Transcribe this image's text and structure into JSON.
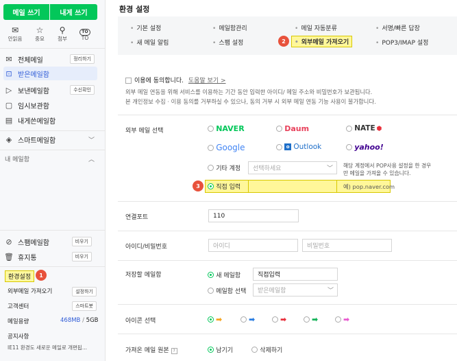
{
  "sidebar": {
    "write_button": "메일 쓰기",
    "self_button": "내게 쓰기",
    "quick": [
      {
        "icon": "envelope-open-icon",
        "label": "안읽음",
        "glyph": "✉"
      },
      {
        "icon": "star-icon",
        "label": "중요",
        "glyph": "☆"
      },
      {
        "icon": "paperclip-icon",
        "label": "첨부",
        "glyph": "⌕"
      },
      {
        "icon": "to-icon",
        "label": "TO",
        "glyph": "TO"
      }
    ],
    "menus": [
      {
        "label": "전체메일",
        "button": "정리하기",
        "icon": "mail-icon",
        "glyph": "✉"
      },
      {
        "label": "받은메일함",
        "icon": "inbox-icon",
        "glyph": "⊡"
      },
      {
        "label": "보낸메일함",
        "button": "수신확인",
        "icon": "send-icon",
        "glyph": "▷"
      },
      {
        "label": "임시보관함",
        "icon": "draft-icon",
        "glyph": "▢"
      },
      {
        "label": "내게쓴메일함",
        "icon": "note-icon",
        "glyph": "▤"
      }
    ],
    "smart": "스마트메일함",
    "my_folders": "내 메일함",
    "spam": {
      "label": "스팸메일함",
      "button": "비우기"
    },
    "trash": {
      "label": "휴지통",
      "button": "비우기"
    },
    "env": "환경설정",
    "external": {
      "label": "외부메일 가져오기",
      "button": "설정하기"
    },
    "support": {
      "label": "고객센터",
      "button": "스마트봇"
    },
    "storage": {
      "label": "메일용량",
      "used": "468MB",
      "sep": "/",
      "total": "5GB"
    },
    "notice": {
      "title": "공지사항",
      "text": "IE11 환경도 새로운 메일로 개편됩..."
    },
    "badge1": "1"
  },
  "main": {
    "title": "환경 설정",
    "tabs": [
      "기본 설정",
      "메일함관리",
      "메일 자동분류",
      "서명/빠른 답장",
      "새 메일 알림",
      "스팸 설정",
      "외부메일 가져오기",
      "POP3/IMAP 설정"
    ],
    "badge2": "2",
    "badge3": "3",
    "consent": {
      "label": "이용에 동의합니다.",
      "link": "도움말 보기 >"
    },
    "desc1": "외부 메일 연동을 위해 서비스를 이용하는 기간 동안 입력한 아이디/ 메일 주소와 비밀번호가 보관됩니다.",
    "desc2": "본 개인정보 수집 · 이용 동의를 거부하실 수 있으나, 동의 거부 시 외부 메일 연동 기능 사용이 불가합니다.",
    "external_select": {
      "label": "외부 메일 선택",
      "providers": [
        "NAVER",
        "Daum",
        "NATE",
        "Google",
        "Outlook",
        "yahoo!"
      ],
      "other_label": "기타 계정",
      "other_placeholder": "선택하세요",
      "other_note": "해당 계정에서 POP사용 설정을 한 경우만 메일을 가져올 수 있습니다.",
      "direct_label": "직접 입력",
      "direct_hint": "예) pop.naver.com"
    },
    "port": {
      "label": "연결포트",
      "value": "110"
    },
    "idpw": {
      "label": "아이디/비밀번호",
      "id_ph": "아이디",
      "pw_ph": "비밀번호"
    },
    "mailbox": {
      "label": "저장할 메일함",
      "new_label": "새 메일함",
      "new_value": "직접입력",
      "select_label": "메일함 선택",
      "select_ph": "받은메일함"
    },
    "icon_select": {
      "label": "아이콘 선택",
      "colors": [
        "#f5a623",
        "#2a7de1",
        "#e8303c",
        "#16b35a",
        "#e85bd0"
      ]
    },
    "original": {
      "label": "가져온 메일 원본",
      "keep": "남기기",
      "delete": "삭제하기"
    }
  }
}
